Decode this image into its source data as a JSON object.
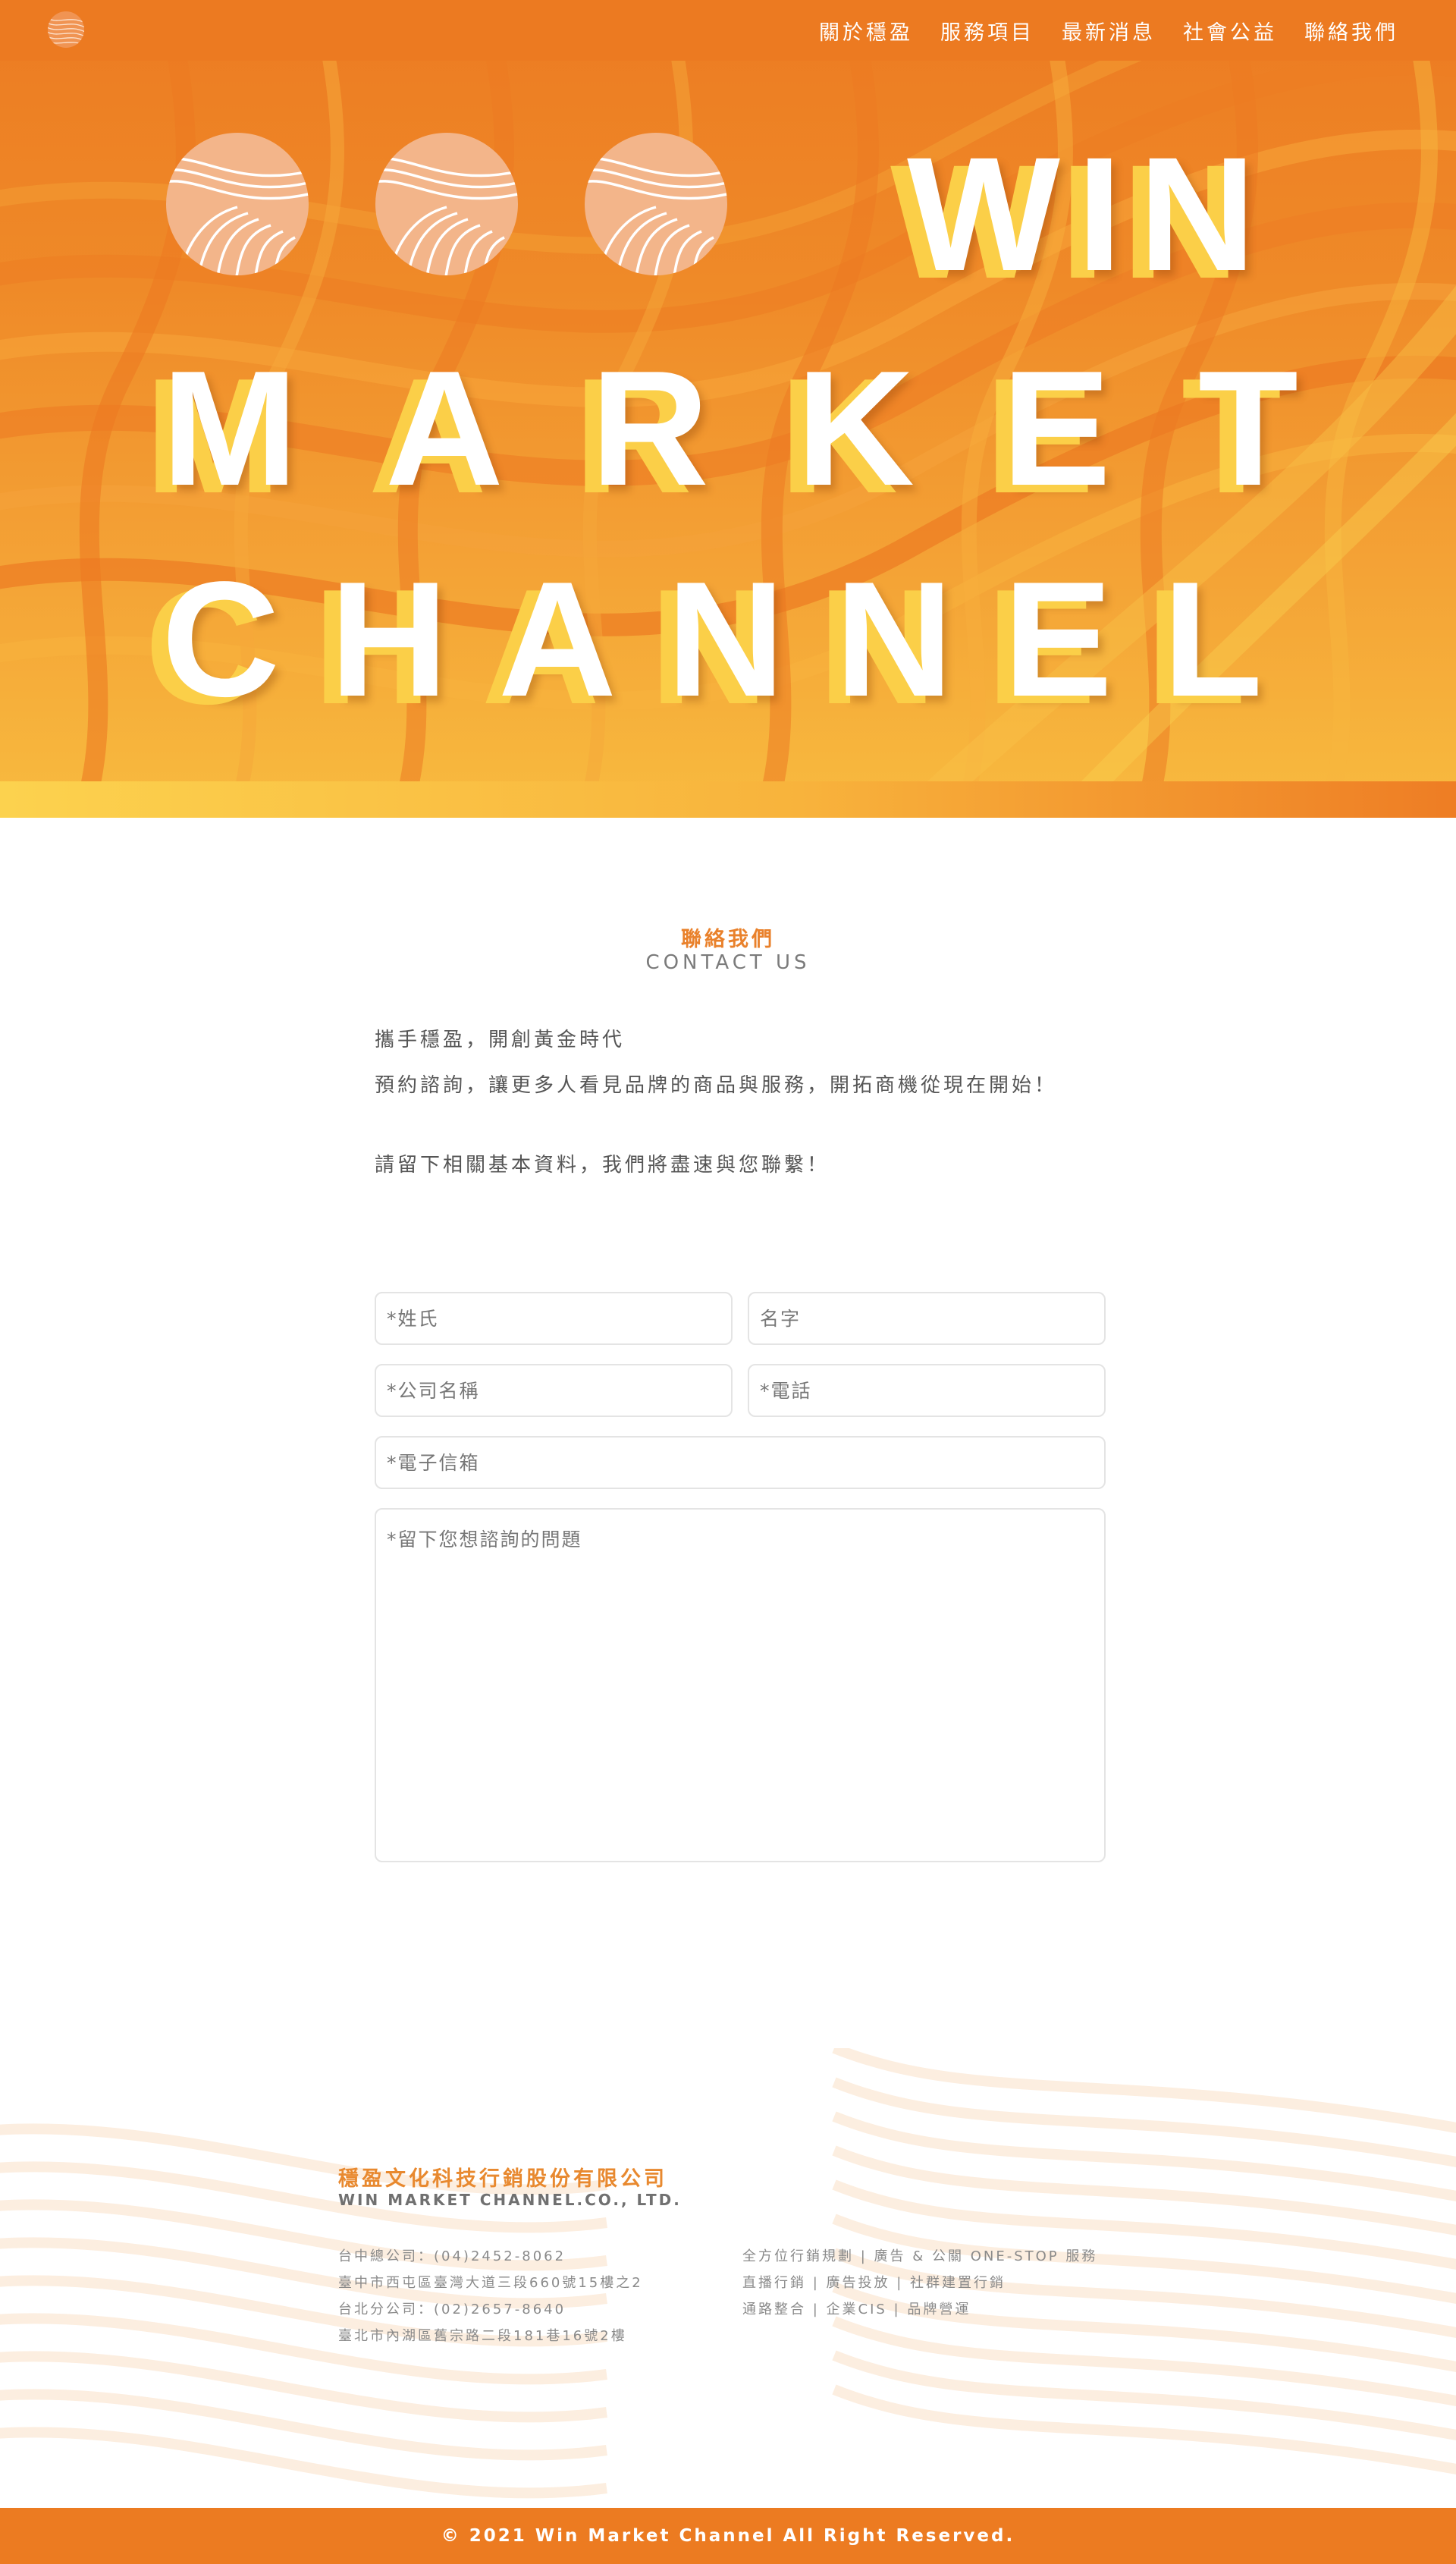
{
  "nav": {
    "items": [
      {
        "label": "關於穩盈"
      },
      {
        "label": "服務項目"
      },
      {
        "label": "最新消息"
      },
      {
        "label": "社會公益"
      },
      {
        "label": "聯絡我們"
      }
    ]
  },
  "hero": {
    "line1": "WIN",
    "line2": "MARKET",
    "line3": "CHANNEL"
  },
  "contact": {
    "title": "聯絡我們",
    "subtitle": "CONTACT US",
    "intro_line1": "攜手穩盈，開創黃金時代",
    "intro_line2": "預約諮詢，讓更多人看見品牌的商品與服務，開拓商機從現在開始！",
    "intro_line3": "請留下相關基本資料，我們將盡速與您聯繫！",
    "form": {
      "last_name_placeholder": "*姓氏",
      "first_name_placeholder": "名字",
      "company_placeholder": "*公司名稱",
      "phone_placeholder": "*電話",
      "email_placeholder": "*電子信箱",
      "message_placeholder": "*留下您想諮詢的問題"
    }
  },
  "footer": {
    "company_name": "穩盈文化科技行銷股份有限公司",
    "company_name_en": "WIN MARKET CHANNEL.CO., LTD.",
    "address_lines": [
      "台中總公司：(04)2452-8062",
      "臺中市西屯區臺灣大道三段660號15樓之2",
      "台北分公司：(02)2657-8640",
      "臺北市內湖區舊宗路二段181巷16號2樓"
    ],
    "service_lines": [
      "全方位行銷規劃 | 廣告 & 公關 ONE-STOP 服務",
      "直播行銷 | 廣告投放 | 社群建置行銷",
      "通路整合 | 企業CIS | 品牌營運"
    ],
    "copyright": "© 2021 Win Market Channel All Right Reserved."
  },
  "colors": {
    "brand_orange": "#ec7b21",
    "accent_yellow": "#fbcf48",
    "title_orange": "#e9812b"
  },
  "icons": {
    "logo": "wave-sphere-logo-icon",
    "orbs": "wave-sphere-icon"
  }
}
